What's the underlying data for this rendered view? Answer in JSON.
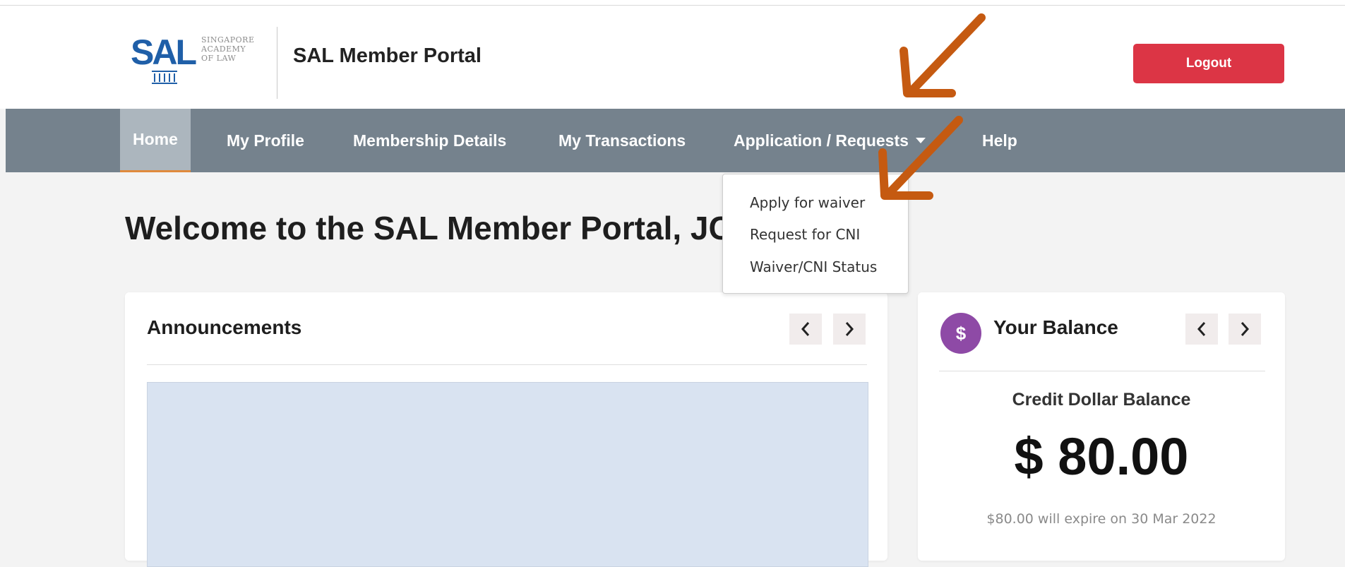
{
  "header": {
    "logo_text": "SAL",
    "logo_subtitle": [
      "SINGAPORE",
      "ACADEMY",
      "OF LAW"
    ],
    "portal_title": "SAL Member Portal",
    "logout_label": "Logout"
  },
  "nav": {
    "items": [
      {
        "label": "Home"
      },
      {
        "label": "My Profile"
      },
      {
        "label": "Membership Details"
      },
      {
        "label": "My Transactions"
      },
      {
        "label": "Application / Requests"
      },
      {
        "label": "Help"
      }
    ]
  },
  "dropdown": {
    "items": [
      "Apply for waiver",
      "Request for CNI",
      "Waiver/CNI Status"
    ]
  },
  "main": {
    "welcome": "Welcome to the SAL Member Portal, JC"
  },
  "announcements": {
    "title": "Announcements",
    "prev_icon": "chevron-left-icon",
    "next_icon": "chevron-right-icon"
  },
  "balance": {
    "title": "Your Balance",
    "coin_symbol": "$",
    "label": "Credit Dollar Balance",
    "amount": "$ 80.00",
    "expiry": "$80.00 will expire on 30 Mar 2022"
  },
  "colors": {
    "navbar": "#75828d",
    "logout": "#dc3545",
    "annotation_arrow": "#c55a11",
    "coin": "#8e4aa6"
  }
}
